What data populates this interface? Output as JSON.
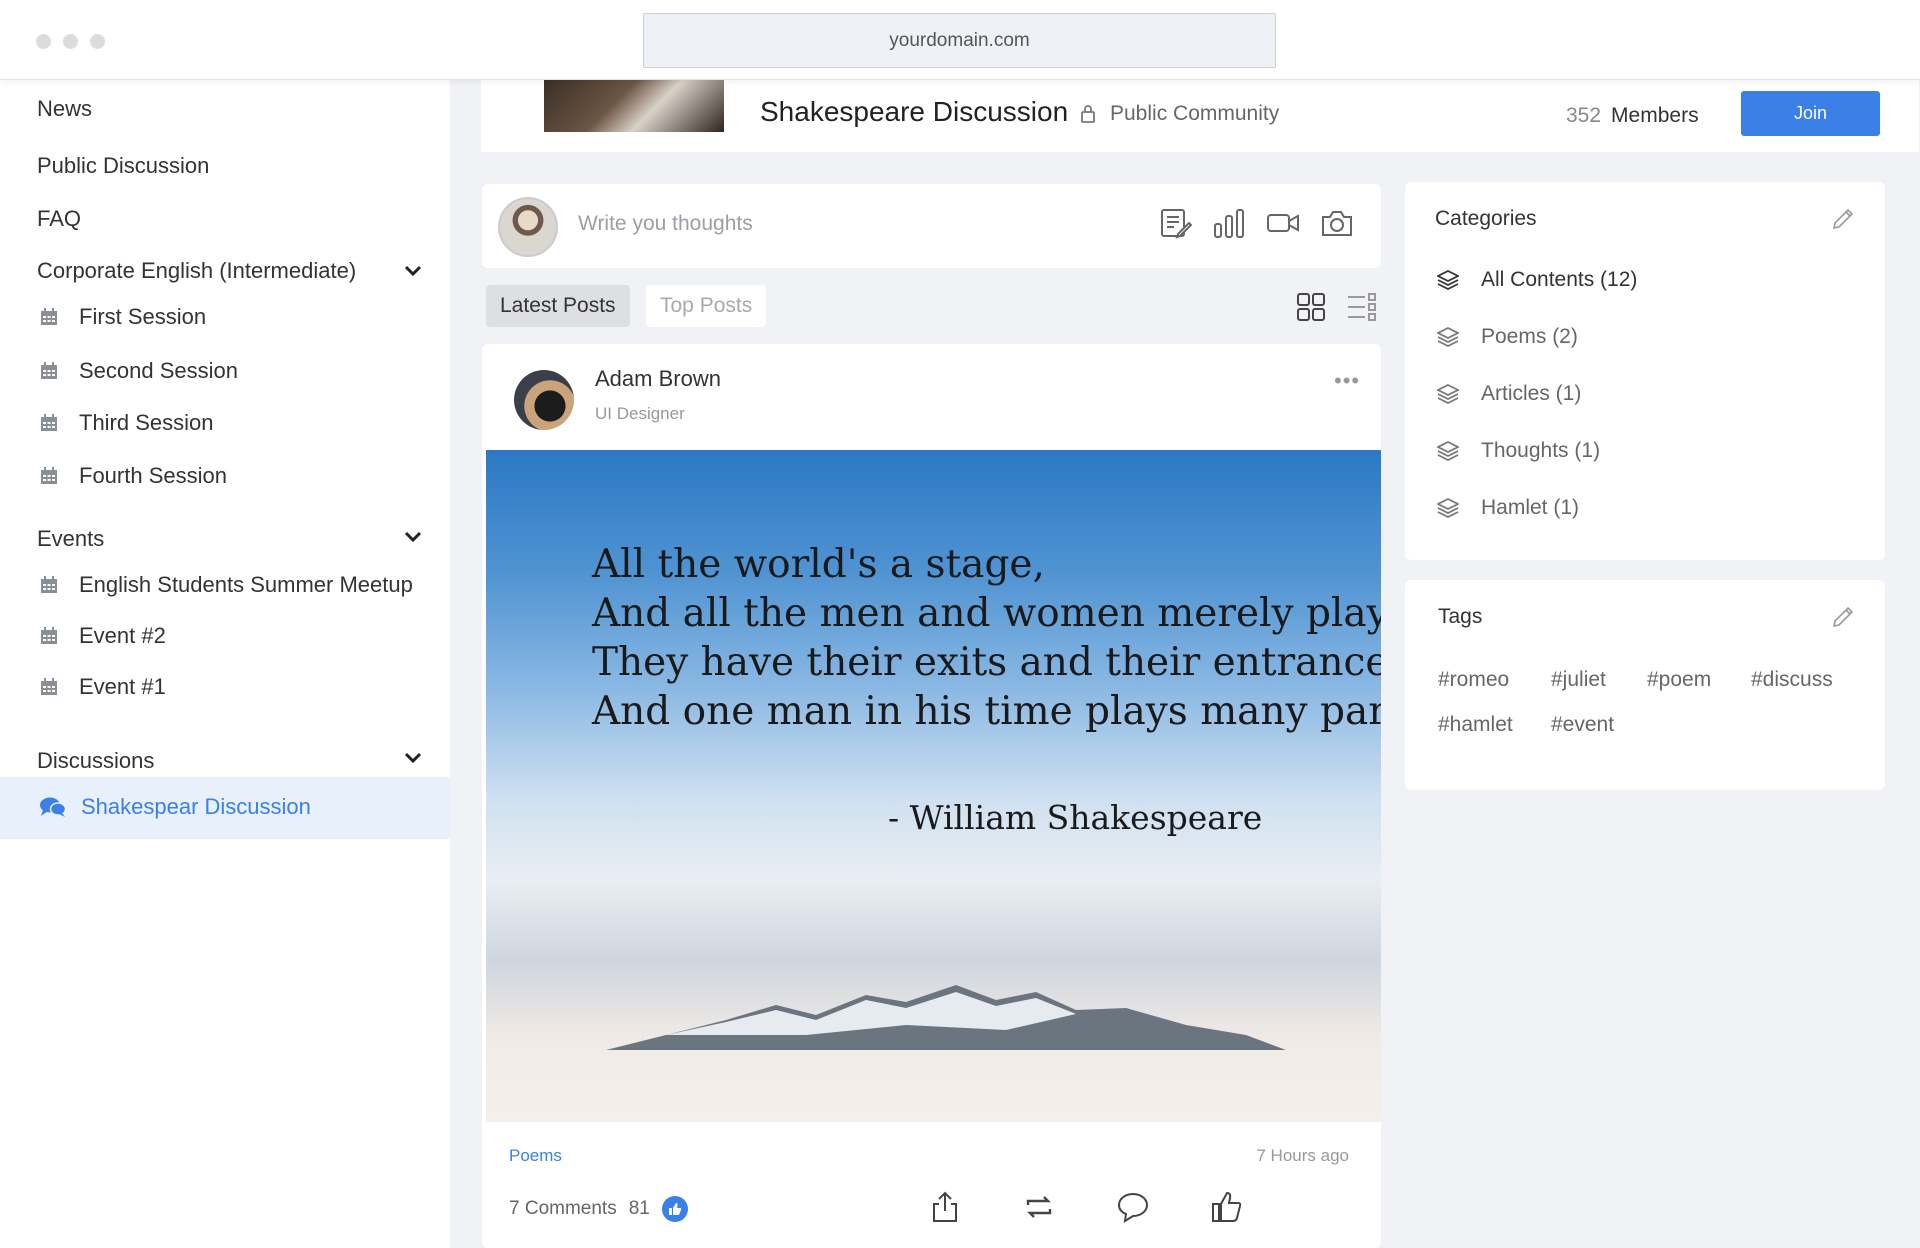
{
  "browser": {
    "url": "yourdomain.com"
  },
  "sidebar": {
    "items": [
      {
        "label": "News"
      },
      {
        "label": "Public Discussion"
      },
      {
        "label": "FAQ"
      }
    ],
    "groups": [
      {
        "label": "Corporate English (Intermediate)",
        "items": [
          "First Session",
          "Second Session",
          "Third Session",
          "Fourth Session"
        ]
      },
      {
        "label": "Events",
        "items": [
          "English Students Summer Meetup",
          "Event #2",
          "Event #1"
        ]
      },
      {
        "label": "Discussions",
        "items": [
          "Shakespear Discussion"
        ],
        "active": "Shakespear Discussion"
      }
    ]
  },
  "group": {
    "title": "Shakespeare Discussion",
    "privacy": "Public Community",
    "member_count": "352",
    "member_label": "Members",
    "join_label": "Join"
  },
  "composer": {
    "placeholder": "Write you thoughts"
  },
  "tabs": {
    "latest": "Latest Posts",
    "top": "Top Posts"
  },
  "post": {
    "author": "Adam Brown",
    "role": "UI Designer",
    "quote_lines": [
      "All the world's a stage,",
      "And all the men and women merely players;",
      "They have their exits and their entrances,",
      "And one man in his time plays many parts"
    ],
    "quote_author": "- William Shakespeare",
    "category": "Poems",
    "time": "7 Hours ago",
    "comments": "7 Comments",
    "likes": "81"
  },
  "categories": {
    "title": "Categories",
    "items": [
      "All Contents (12)",
      "Poems (2)",
      "Articles (1)",
      "Thoughts (1)",
      "Hamlet (1)"
    ]
  },
  "tags": {
    "title": "Tags",
    "items": [
      "#romeo",
      "#juliet",
      "#poem",
      "#discuss",
      "#hamlet",
      "#event"
    ]
  },
  "colors": {
    "accent": "#3a80e6",
    "background": "#f1f2f5",
    "active_row": "#e8f0fb"
  }
}
